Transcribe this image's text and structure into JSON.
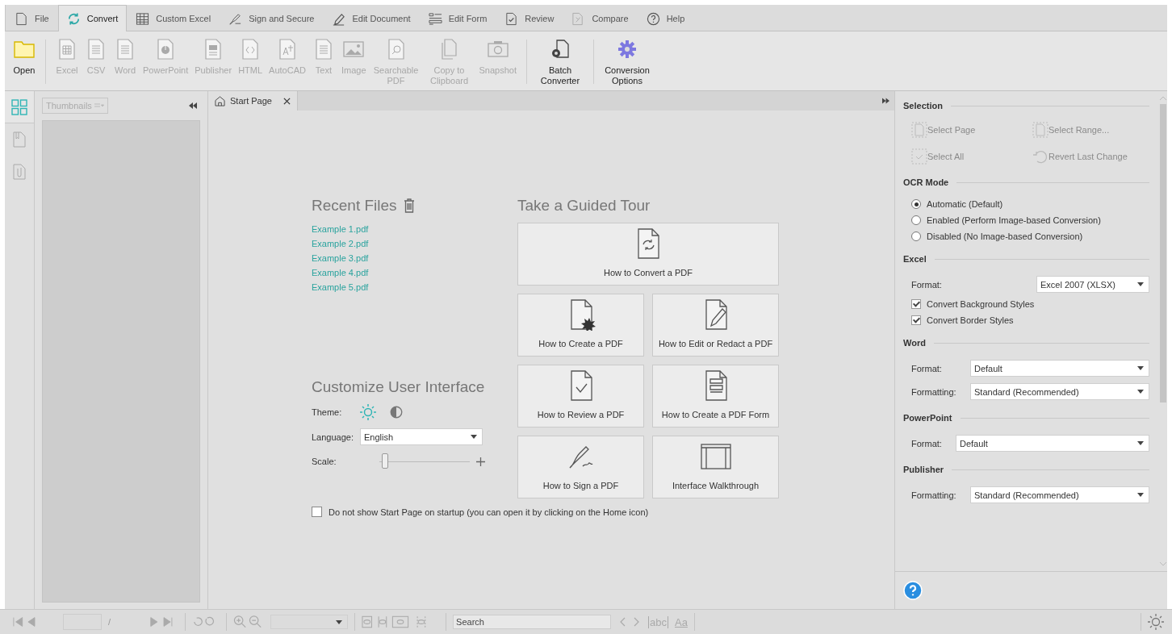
{
  "menu_tabs": [
    {
      "label": "File",
      "selected": false
    },
    {
      "label": "Convert",
      "selected": true
    },
    {
      "label": "Custom Excel",
      "selected": false
    },
    {
      "label": "Sign and Secure",
      "selected": false
    },
    {
      "label": "Edit Document",
      "selected": false
    },
    {
      "label": "Edit Form",
      "selected": false
    },
    {
      "label": "Review",
      "selected": false
    },
    {
      "label": "Compare",
      "selected": false
    },
    {
      "label": "Help",
      "selected": false
    }
  ],
  "ribbon": [
    {
      "label": "Open",
      "disabled": false
    },
    {
      "label": "Excel",
      "disabled": true
    },
    {
      "label": "CSV",
      "disabled": true
    },
    {
      "label": "Word",
      "disabled": true
    },
    {
      "label": "PowerPoint",
      "disabled": true
    },
    {
      "label": "Publisher",
      "disabled": true
    },
    {
      "label": "HTML",
      "disabled": true
    },
    {
      "label": "AutoCAD",
      "disabled": true
    },
    {
      "label": "Text",
      "disabled": true
    },
    {
      "label": "Image",
      "disabled": true
    },
    {
      "label": "Searchable PDF",
      "disabled": true
    },
    {
      "label": "Copy to Clipboard",
      "disabled": true
    },
    {
      "label": "Snapshot",
      "disabled": true
    },
    {
      "label": "Batch Converter",
      "disabled": false
    },
    {
      "label": "Conversion Options",
      "disabled": false
    }
  ],
  "side_tabs": [
    {
      "selected": true
    },
    {
      "selected": false
    },
    {
      "selected": false
    }
  ],
  "thumbnails": {
    "dropdown": "Thumbnails"
  },
  "doc_tabs": [
    {
      "label": "Start Page",
      "selected": true
    }
  ],
  "start_page": {
    "recent_title": "Recent Files",
    "recent_files": [
      "Example 1.pdf",
      "Example 2.pdf",
      "Example 3.pdf",
      "Example 4.pdf",
      "Example 5.pdf"
    ],
    "tour_title": "Take a Guided Tour",
    "tours": [
      "How to Convert a PDF",
      "How to Create a PDF",
      "How to Edit or Redact a PDF",
      "How to Review a PDF",
      "How to Create a PDF Form",
      "How to Sign a PDF",
      "Interface Walkthrough"
    ],
    "customize_title": "Customize User Interface",
    "theme_label": "Theme:",
    "themes": [
      {
        "selected": true
      },
      {
        "selected": false
      }
    ],
    "language_label": "Language:",
    "language": "English",
    "scale_label": "Scale:",
    "scale": {
      "level": 0.03
    },
    "startup_checkbox": {
      "label": "Do not show Start Page on startup (you can open it by clicking on the Home icon)",
      "checked": false
    }
  },
  "options": {
    "selection_title": "Selection",
    "selection_buttons": [
      {
        "label": "Select Page",
        "disabled": true
      },
      {
        "label": "Select Range...",
        "disabled": true
      },
      {
        "label": "Select All",
        "disabled": true
      },
      {
        "label": "Revert Last Change",
        "disabled": true
      }
    ],
    "ocr_title": "OCR Mode",
    "ocr_modes": [
      {
        "label": "Automatic (Default)",
        "selected": true
      },
      {
        "label": "Enabled (Perform Image-based Conversion)",
        "selected": false
      },
      {
        "label": "Disabled (No Image-based Conversion)",
        "selected": false
      }
    ],
    "sections": [
      {
        "title": "Excel",
        "fields": [
          {
            "label": "Format:",
            "value": "Excel 2007 (XLSX)",
            "kind": "narrow"
          }
        ],
        "checkboxes": [
          {
            "label": "Convert Background Styles",
            "checked": true
          },
          {
            "label": "Convert Border Styles",
            "checked": true
          }
        ]
      },
      {
        "title": "Word",
        "fields": [
          {
            "label": "Format:",
            "value": "Default",
            "kind": "wide"
          },
          {
            "label": "Formatting:",
            "value": "Standard (Recommended)",
            "kind": "wide"
          }
        ]
      },
      {
        "title": "PowerPoint",
        "fields": [
          {
            "label": "Format:",
            "value": "Default",
            "kind": "tight"
          }
        ]
      },
      {
        "title": "Publisher",
        "fields": [
          {
            "label": "Formatting:",
            "value": "Standard (Recommended)",
            "kind": "wide"
          }
        ]
      }
    ]
  },
  "status_bar": {
    "page_separator": "/",
    "search_placeholder": "Search",
    "match_word": "abc",
    "match_case": "Aa"
  }
}
